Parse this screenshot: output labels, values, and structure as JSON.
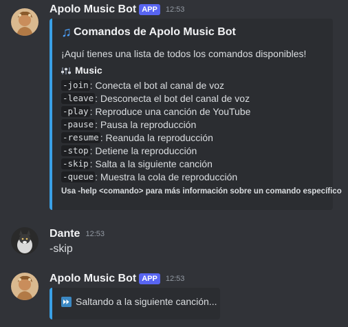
{
  "messages": [
    {
      "username": "Apolo Music Bot",
      "badge": "APP",
      "time": "12:53",
      "embed": {
        "title": "Comandos de Apolo Music Bot",
        "title_icon": "musical-notes-icon",
        "description": "¡Aquí tienes una lista de todos los comandos disponibles!",
        "section_title": "Music",
        "section_icon": "control-knobs-icon",
        "commands": [
          {
            "cmd": "-join",
            "desc": ": Conecta el bot al canal de voz"
          },
          {
            "cmd": "-leave",
            "desc": ": Desconecta el bot del canal de voz"
          },
          {
            "cmd": "-play",
            "desc": ": Reproduce una canción de YouTube"
          },
          {
            "cmd": "-pause",
            "desc": ": Pausa la reproducción"
          },
          {
            "cmd": "-resume",
            "desc": ": Reanuda la reproducción"
          },
          {
            "cmd": "-stop",
            "desc": ": Detiene la reproducción"
          },
          {
            "cmd": "-skip",
            "desc": ": Salta a la siguiente canción"
          },
          {
            "cmd": "-queue",
            "desc": ": Muestra la cola de reproducción"
          }
        ],
        "footer": "Usa -help <comando> para más información sobre un comando específico",
        "accent": "#3aa0e6"
      }
    },
    {
      "username": "Dante",
      "time": "12:53",
      "text": "-skip"
    },
    {
      "username": "Apolo Music Bot",
      "badge": "APP",
      "time": "12:53",
      "embed": {
        "icon": "fast-forward-icon",
        "text": "Saltando a la siguiente canción..."
      }
    }
  ],
  "colors": {
    "background": "#313338",
    "embed_bg": "#2b2d31",
    "app_badge": "#5865f2"
  }
}
